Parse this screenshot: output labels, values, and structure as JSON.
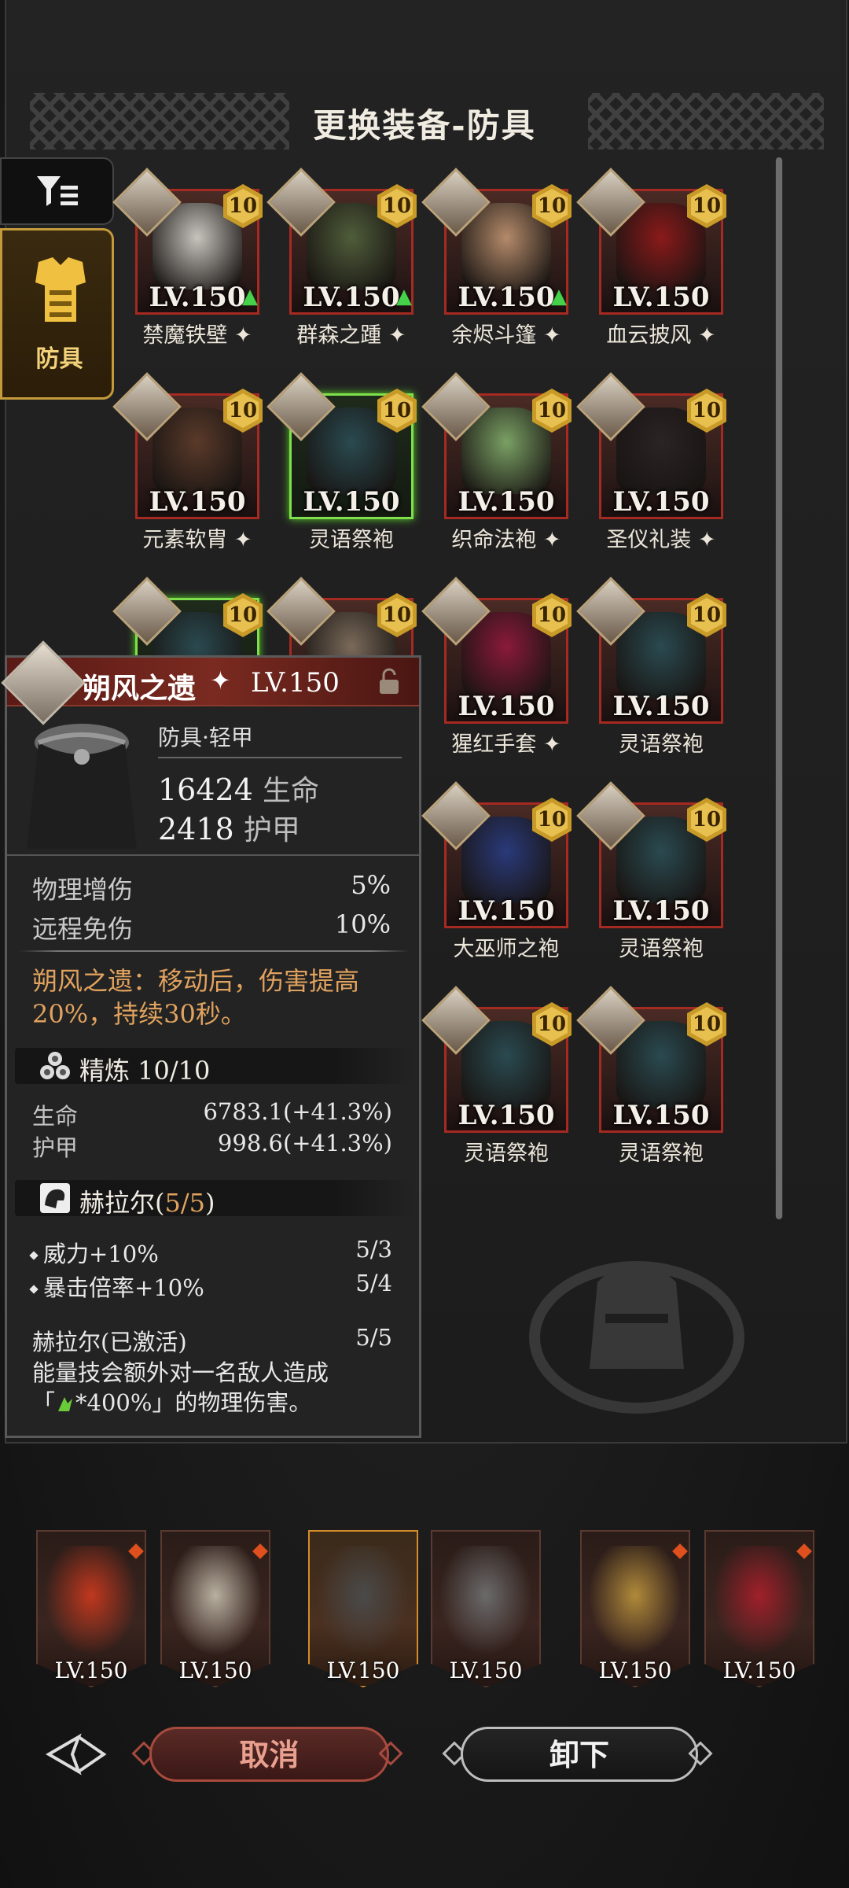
{
  "header": {
    "title": "更换装备-防具"
  },
  "tabs": [
    {
      "label": "",
      "icon": "filter-icon"
    },
    {
      "label": "防具",
      "icon": "armor-icon"
    }
  ],
  "grid": {
    "items": [
      {
        "name": "禁魔铁壁",
        "level": "LV.150",
        "badge": "10",
        "upgrade": true,
        "starred": true,
        "green": false,
        "color": "#c7c3bd"
      },
      {
        "name": "群森之踵",
        "level": "LV.150",
        "badge": "10",
        "upgrade": true,
        "starred": true,
        "green": false,
        "color": "#4f5d3a"
      },
      {
        "name": "余烬斗篷",
        "level": "LV.150",
        "badge": "10",
        "upgrade": true,
        "starred": true,
        "green": false,
        "color": "#b48a6a"
      },
      {
        "name": "血云披风",
        "level": "LV.150",
        "badge": "10",
        "upgrade": false,
        "starred": true,
        "green": false,
        "color": "#8a1a1a"
      },
      {
        "name": "元素软胄",
        "level": "LV.150",
        "badge": "10",
        "upgrade": false,
        "starred": true,
        "green": false,
        "color": "#5a3a2a"
      },
      {
        "name": "灵语祭袍",
        "level": "LV.150",
        "badge": "10",
        "upgrade": false,
        "starred": false,
        "green": true,
        "color": "#2a4a50"
      },
      {
        "name": "织命法袍",
        "level": "LV.150",
        "badge": "10",
        "upgrade": false,
        "starred": true,
        "green": false,
        "color": "#7aa064"
      },
      {
        "name": "圣仪礼装",
        "level": "LV.150",
        "badge": "10",
        "upgrade": false,
        "starred": true,
        "green": false,
        "color": "#2a2424"
      },
      {
        "name": "",
        "level": "",
        "badge": "10",
        "upgrade": false,
        "starred": false,
        "green": true,
        "color": "#2a4a50"
      },
      {
        "name": "",
        "level": "",
        "badge": "10",
        "upgrade": false,
        "starred": false,
        "green": false,
        "color": "#7a6a5a"
      },
      {
        "name": "猩红手套",
        "level": "LV.150",
        "badge": "10",
        "upgrade": false,
        "starred": true,
        "green": false,
        "color": "#8a1a3a"
      },
      {
        "name": "灵语祭袍",
        "level": "LV.150",
        "badge": "10",
        "upgrade": false,
        "starred": false,
        "green": false,
        "color": "#2a4a50"
      },
      {
        "name": "大巫师之袍",
        "level": "LV.150",
        "badge": "10",
        "upgrade": false,
        "starred": false,
        "green": false,
        "color": "#2a3a7a"
      },
      {
        "name": "灵语祭袍",
        "level": "LV.150",
        "badge": "10",
        "upgrade": false,
        "starred": false,
        "green": false,
        "color": "#2a4a50"
      },
      {
        "name": "灵语祭袍",
        "level": "LV.150",
        "badge": "10",
        "upgrade": false,
        "starred": false,
        "green": false,
        "color": "#2a4a50"
      },
      {
        "name": "灵语祭袍",
        "level": "LV.150",
        "badge": "10",
        "upgrade": false,
        "starred": false,
        "green": false,
        "color": "#2a4a50"
      }
    ]
  },
  "detail": {
    "name": "朔风之遗",
    "level": "LV.150",
    "type": "防具·轻甲",
    "main_stats": [
      {
        "value": "16424",
        "unit": "生命"
      },
      {
        "value": "2418",
        "unit": "护甲"
      }
    ],
    "sub_stats": [
      {
        "label": "物理增伤",
        "value": "5%"
      },
      {
        "label": "远程免伤",
        "value": "10%"
      }
    ],
    "effect": "朔风之遗：移动后，伤害提高20%，持续30秒。",
    "refine": {
      "title": "精炼 10/10",
      "rows": [
        {
          "label": "生命",
          "value": "6783.1(+41.3%)"
        },
        {
          "label": "护甲",
          "value": "998.6(+41.3%)"
        }
      ]
    },
    "set": {
      "title_name": "赫拉尔(",
      "title_count": "5/5",
      "title_end": ")",
      "bonuses": [
        {
          "label": "威力+10%",
          "value": "5/3"
        },
        {
          "label": "暴击倍率+10%",
          "value": "5/4"
        }
      ],
      "active_label": "赫拉尔(已激活)",
      "active_value": "5/5",
      "active_desc_1": "能量技会额外对一名敌人造成",
      "active_desc_2": "「",
      "active_desc_3": "*400%」的物理伤害。"
    }
  },
  "equipped": [
    {
      "level": "LV.150",
      "color": "#c0381e"
    },
    {
      "level": "LV.150",
      "color": "#b8b0a0"
    },
    {
      "level": "LV.150",
      "color": "#4a4a4a",
      "selected": true
    },
    {
      "level": "LV.150",
      "color": "#6a6a6a"
    },
    {
      "level": "LV.150",
      "color": "#b08a3a"
    },
    {
      "level": "LV.150",
      "color": "#a0202a"
    }
  ],
  "buttons": {
    "cancel": "取消",
    "unequip": "卸下"
  }
}
